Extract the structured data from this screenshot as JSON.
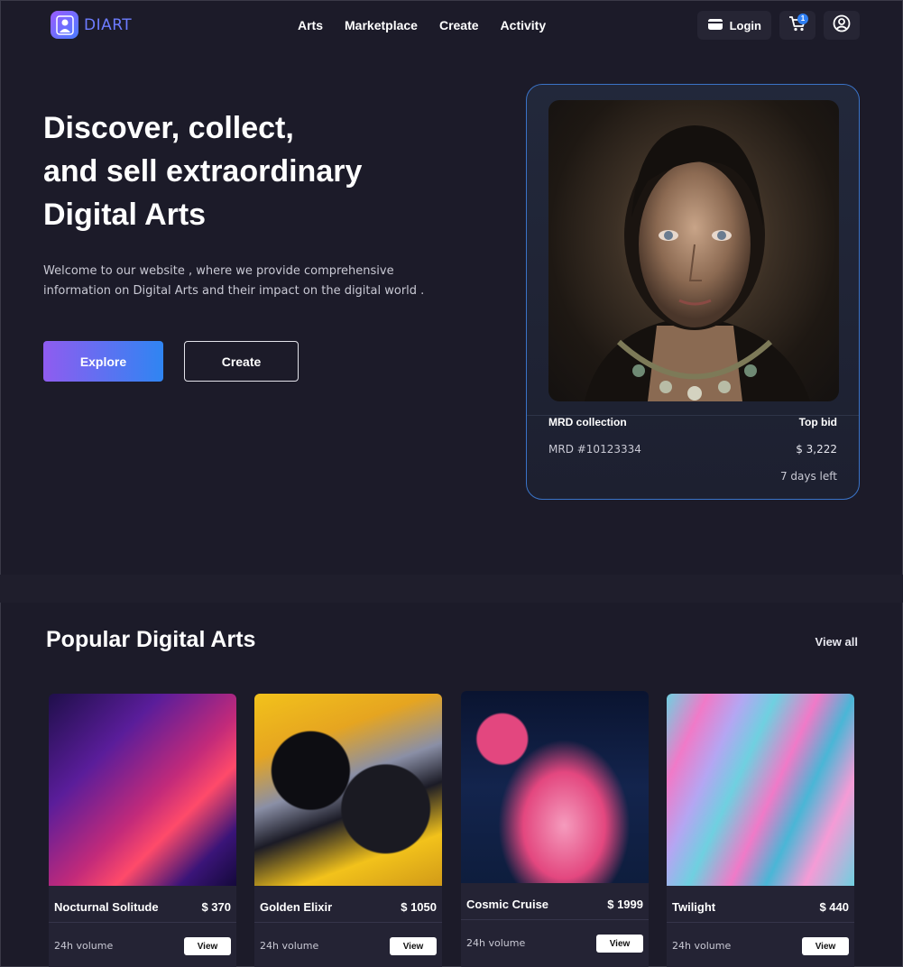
{
  "brand": {
    "name": "DIART"
  },
  "nav": {
    "links": [
      "Arts",
      "Marketplace",
      "Create",
      "Activity"
    ],
    "login_label": "Login",
    "cart_count": "1"
  },
  "hero": {
    "title_lines": [
      "Discover, collect,",
      "and sell extraordinary",
      "Digital Arts"
    ],
    "description": "Welcome to our website , where we provide comprehensive information on Digital Arts and their impact on the digital world .",
    "explore_label": "Explore",
    "create_label": "Create"
  },
  "featured": {
    "collection": "MRD collection",
    "top_bid_label": "Top bid",
    "item_id": "MRD #10123334",
    "price": "$ 3,222",
    "time_left": "7 days left"
  },
  "popular": {
    "title": "Popular Digital Arts",
    "view_all": "View all",
    "volume_label": "24h volume",
    "view_label": "View",
    "items": [
      {
        "name": "Nocturnal Solitude",
        "price": "$ 370",
        "palette": [
          "#2a1560",
          "#7a1fa8",
          "#d2327a",
          "#3c1a7a"
        ]
      },
      {
        "name": "Golden Elixir",
        "price": "$ 1050",
        "palette": [
          "#f2c21b",
          "#0d0d12",
          "#8a8fa6",
          "#e6a520"
        ]
      },
      {
        "name": "Cosmic Cruise",
        "price": "$ 1999",
        "palette": [
          "#0a1430",
          "#e3477f",
          "#f59bbd",
          "#0e1d3d"
        ]
      },
      {
        "name": "Twilight",
        "price": "$ 440",
        "palette": [
          "#6fd0e0",
          "#f07ac8",
          "#b4a6f2",
          "#4ab6d6"
        ]
      }
    ]
  },
  "colors": {
    "background": "#1c1b29",
    "accent_blue": "#2f85f2",
    "accent_purple": "#8f5cf0"
  }
}
